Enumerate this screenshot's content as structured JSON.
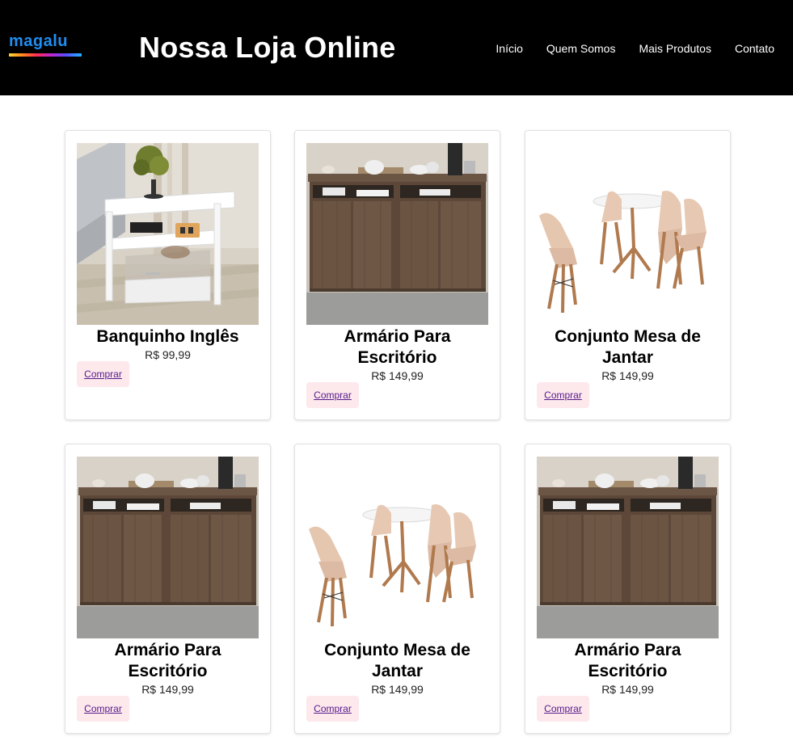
{
  "header": {
    "logo_text": "magalu",
    "title": "Nossa Loja Online",
    "nav": [
      "Início",
      "Quem Somos",
      "Mais Produtos",
      "Contato"
    ]
  },
  "products": [
    {
      "name": "Banquinho Inglês",
      "price": "R$ 99,99",
      "button": "Comprar",
      "image": "white-nightstand"
    },
    {
      "name": "Armário Para Escritório",
      "price": "R$ 149,99",
      "button": "Comprar",
      "image": "wood-sideboard"
    },
    {
      "name": "Conjunto Mesa de Jantar",
      "price": "R$ 149,99",
      "button": "Comprar",
      "image": "table-chairs"
    },
    {
      "name": "Armário Para Escritório",
      "price": "R$ 149,99",
      "button": "Comprar",
      "image": "wood-sideboard"
    },
    {
      "name": "Conjunto Mesa de Jantar",
      "price": "R$ 149,99",
      "button": "Comprar",
      "image": "table-chairs"
    },
    {
      "name": "Armário Para Escritório",
      "price": "R$ 149,99",
      "button": "Comprar",
      "image": "wood-sideboard"
    }
  ],
  "colors": {
    "header_bg": "#000000",
    "button_bg": "#fde8ec",
    "link": "#551a8b"
  }
}
